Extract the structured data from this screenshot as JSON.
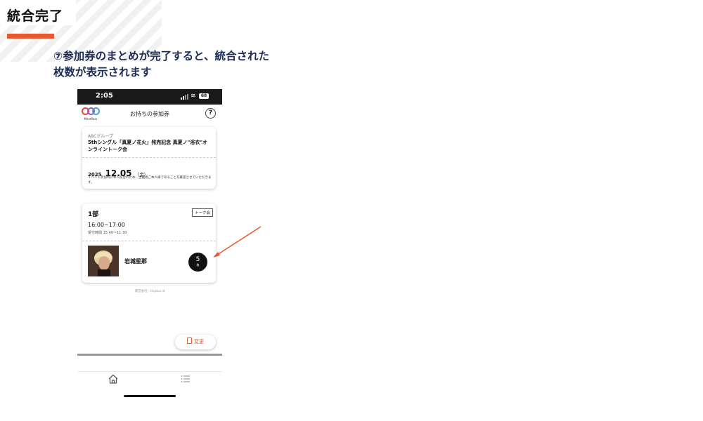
{
  "slide": {
    "title": "統合完了",
    "instruction": "⑦参加券のまとめが完了すると、統合された枚数が表示されます",
    "accent_color": "#e8572f",
    "instruction_color": "#1c2d55"
  },
  "phone": {
    "status_bar": {
      "time": "2:05",
      "battery": "68"
    },
    "header": {
      "logo_text": "MeetPass",
      "title": "お持ちの参加券",
      "help": "?"
    },
    "event_card": {
      "organizer": "ABCグループ",
      "title": "5thシングル「真夏ノ花火」発売記念 真夏ノ\"浴衣\"オンライントーク会",
      "date_year": "2025",
      "date_md": "12.05",
      "date_dow": "（金）",
      "notice": "イベント参加時に本人照合のため、当選者ご本人様であることを確認させていただきます。"
    },
    "session_card": {
      "name": "1部",
      "tag": "トーク会",
      "time": "16:00~17:00",
      "reception": "受付時間 15:40～11:30",
      "member_name": "岩城星那",
      "ticket_count": "5",
      "ticket_unit": "枚"
    },
    "company": "運営会社：tixplus.id",
    "change_button": "変更",
    "nav": {
      "items": [
        "home-icon",
        "list-icon"
      ]
    }
  }
}
